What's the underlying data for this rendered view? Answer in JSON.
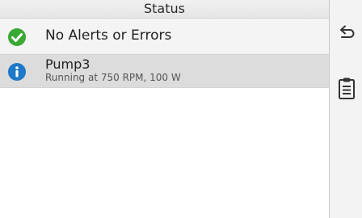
{
  "header": {
    "title": "Status"
  },
  "status_items": [
    {
      "type": "ok",
      "icon": "check-circle-icon",
      "title": "No Alerts or Errors"
    },
    {
      "type": "info",
      "icon": "info-icon",
      "title": "Pump3",
      "subtitle": "Running at 750 RPM, 100 W"
    }
  ],
  "sidebar": {
    "back_icon": "back-arrow-icon",
    "clipboard_icon": "clipboard-icon"
  },
  "colors": {
    "ok_green": "#3aa835",
    "info_blue": "#1f78c8",
    "selected_row": "#dcdcdc"
  }
}
